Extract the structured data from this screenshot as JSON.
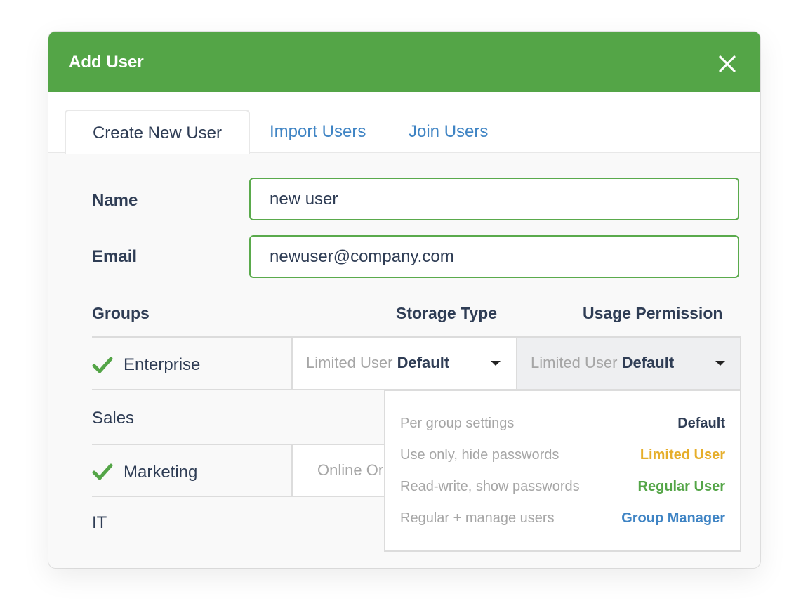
{
  "dialog": {
    "title": "Add User",
    "close_icon": "close-icon",
    "colors": {
      "header": "#54a547",
      "link": "#3f84c4",
      "text": "#2f3d55"
    }
  },
  "tabs": [
    {
      "label": "Create New User",
      "active": true
    },
    {
      "label": "Import Users",
      "active": false
    },
    {
      "label": "Join Users",
      "active": false
    }
  ],
  "form": {
    "name_label": "Name",
    "name_value": "new user",
    "email_label": "Email",
    "email_value": "newuser@company.com"
  },
  "groups_table": {
    "headers": {
      "groups": "Groups",
      "storage": "Storage Type",
      "permission": "Usage Permission"
    },
    "rows": [
      {
        "name": "Enterprise",
        "checked": true,
        "storage_muted": "Limited User",
        "storage_strong": "Default",
        "permission_muted": "Limited User",
        "permission_strong": "Default"
      },
      {
        "name": "Sales",
        "checked": false
      },
      {
        "name": "Marketing",
        "checked": true,
        "storage_muted": "Online Or"
      },
      {
        "name": "IT",
        "checked": false
      }
    ]
  },
  "permission_dropdown": {
    "options": [
      {
        "description": "Per group settings",
        "value": "Default",
        "color": "#2f3d55"
      },
      {
        "description": "Use only, hide passwords",
        "value": "Limited User",
        "color": "#e6ae2a"
      },
      {
        "description": "Read-write, show passwords",
        "value": "Regular User",
        "color": "#54a547"
      },
      {
        "description": "Regular + manage users",
        "value": "Group Manager",
        "color": "#3f84c4"
      }
    ]
  }
}
